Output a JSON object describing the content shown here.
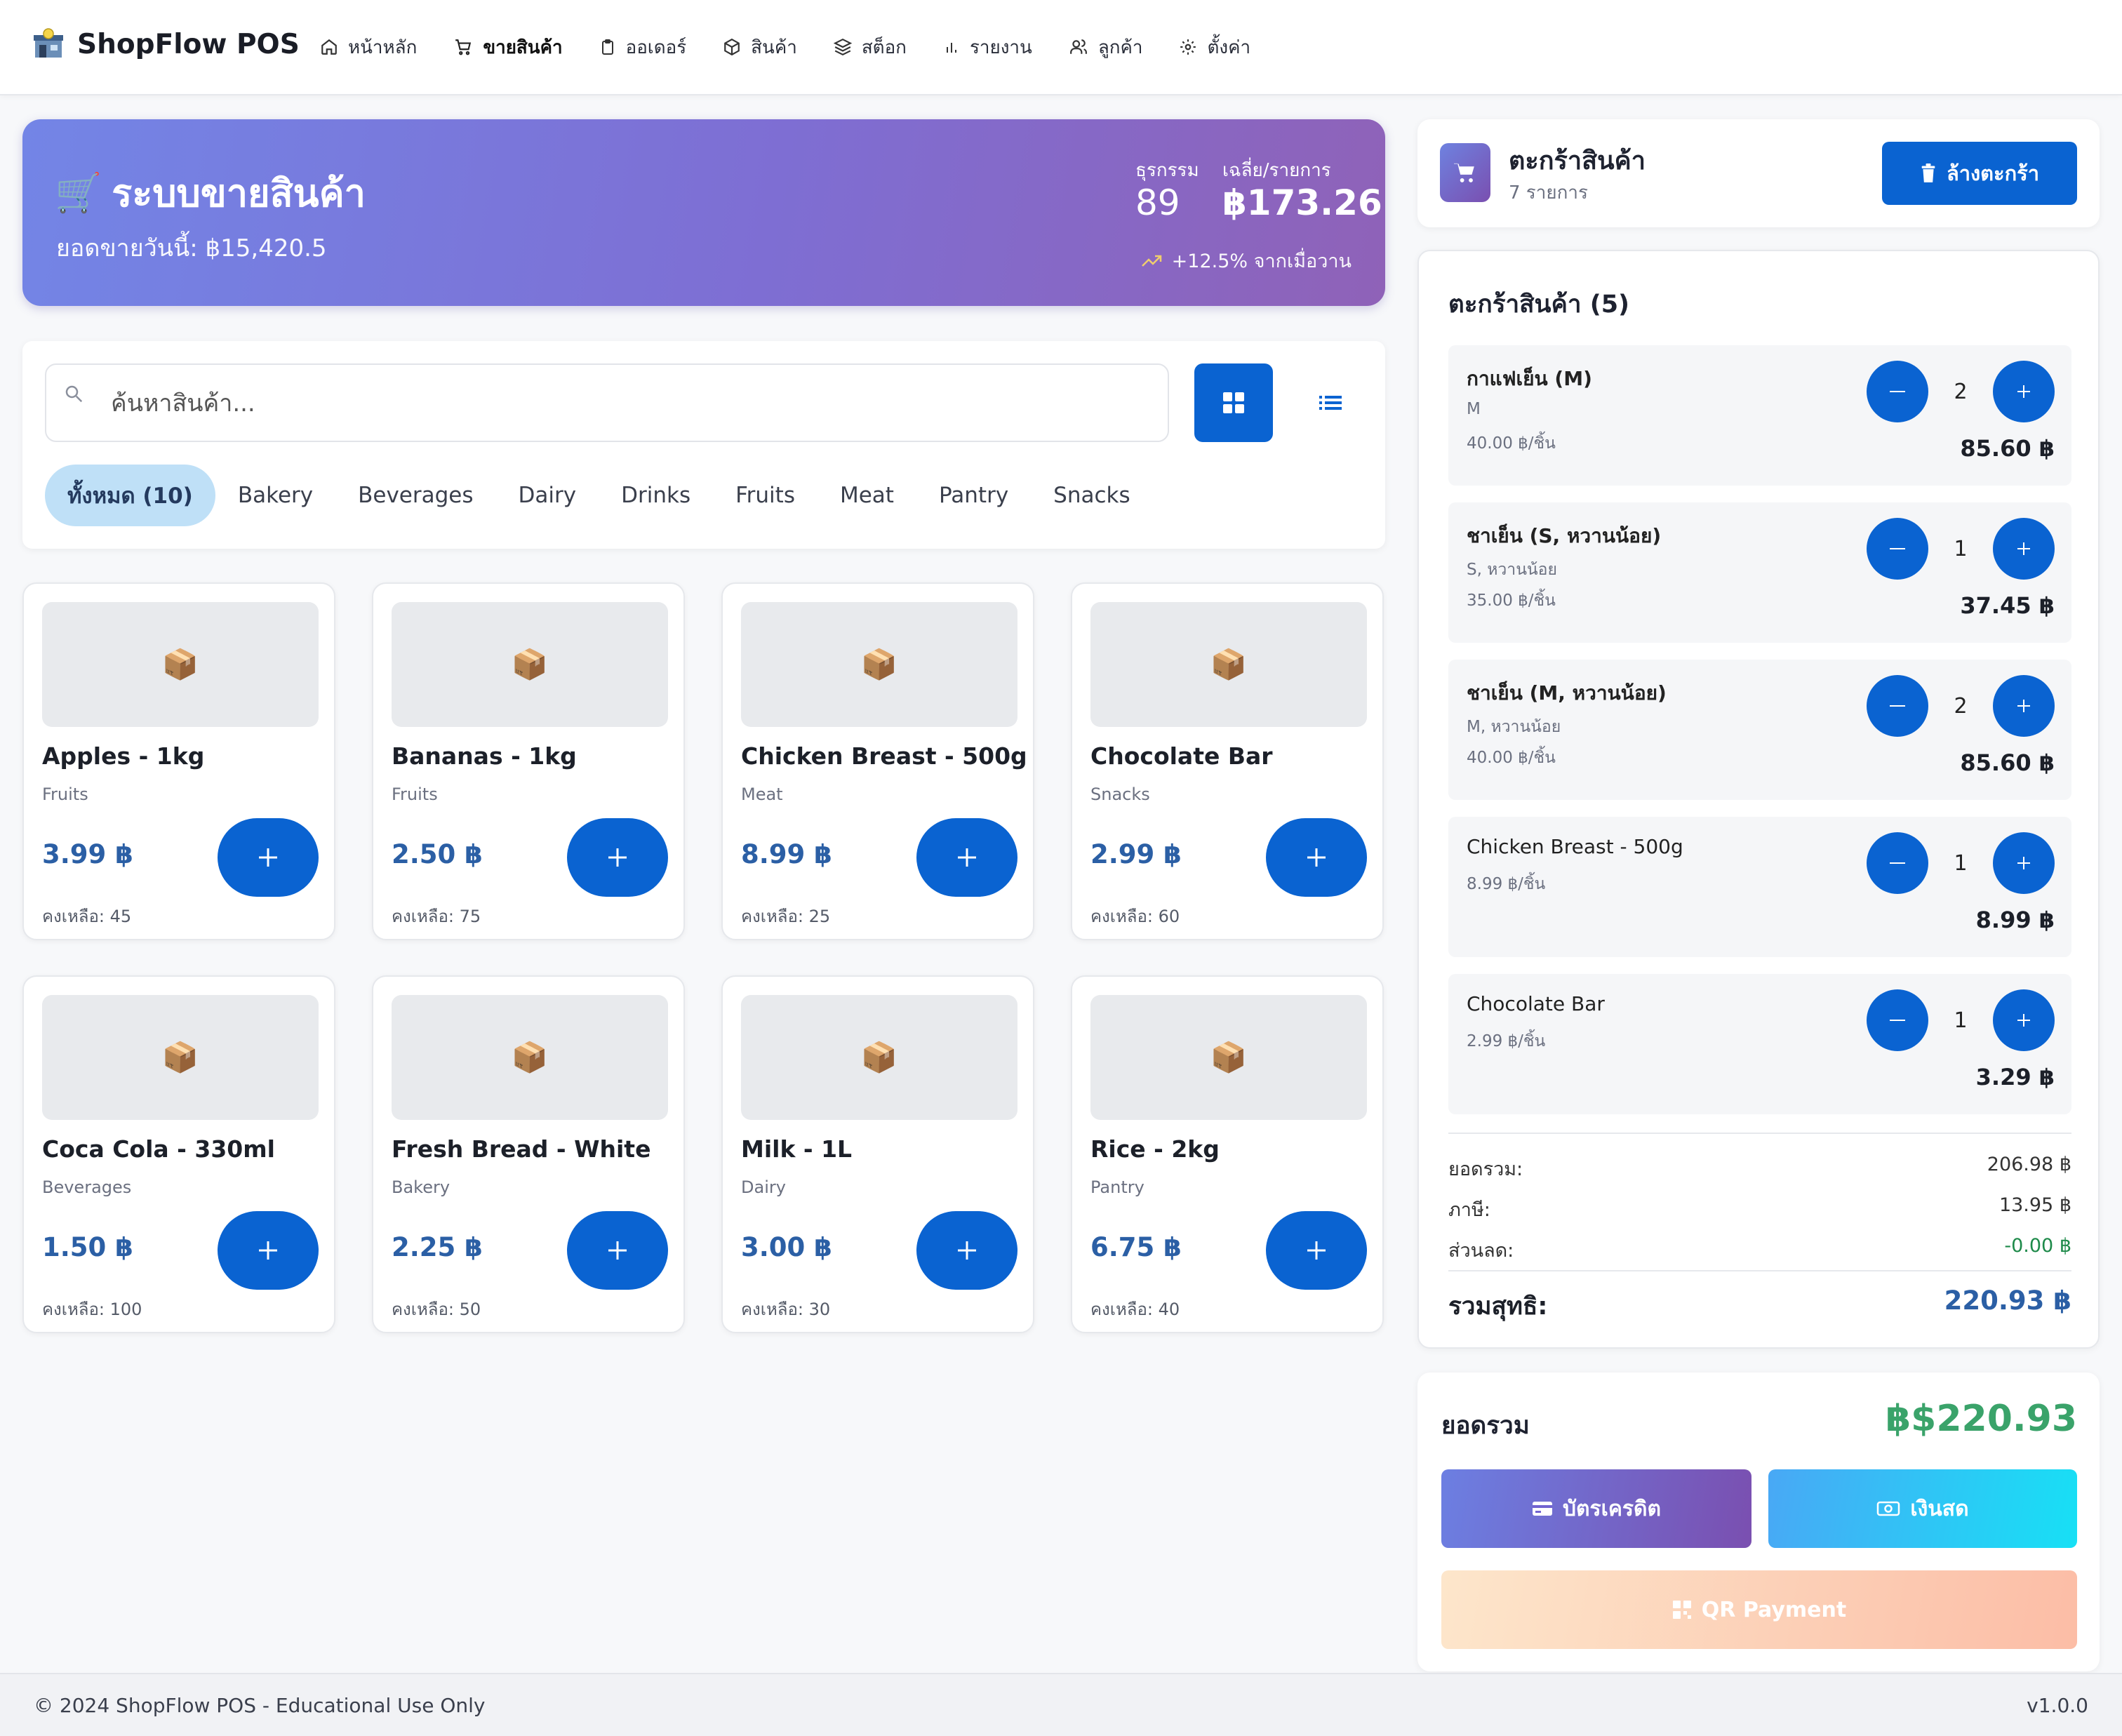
{
  "app": {
    "title": "ShopFlow POS",
    "logo_icon": "store-icon"
  },
  "nav": {
    "items": [
      {
        "label": "หน้าหลัก",
        "icon": "home-icon"
      },
      {
        "label": "ขายสินค้า",
        "icon": "cart-icon",
        "active": true
      },
      {
        "label": "ออเดอร์",
        "icon": "clipboard-icon"
      },
      {
        "label": "สินค้า",
        "icon": "box-icon"
      },
      {
        "label": "สต็อก",
        "icon": "layers-icon"
      },
      {
        "label": "รายงาน",
        "icon": "bar-chart-icon"
      },
      {
        "label": "ลูกค้า",
        "icon": "users-icon"
      },
      {
        "label": "ตั้งค่า",
        "icon": "gear-icon"
      }
    ]
  },
  "hero": {
    "emoji": "🛒",
    "title": "ระบบขายสินค้า",
    "subtitle": "ยอดขายวันนี้: ฿15,420.5",
    "transactions_label": "ธุรกรรม",
    "transactions_value": "89",
    "average_label": "เฉลี่ย/รายการ",
    "average_value": "฿173.26",
    "growth_text": "+12.5% จากเมื่อวาน"
  },
  "search": {
    "placeholder": "ค้นหาสินค้า..."
  },
  "categories": [
    "ทั้งหมด (10)",
    "Bakery",
    "Beverages",
    "Dairy",
    "Drinks",
    "Fruits",
    "Meat",
    "Pantry",
    "Snacks"
  ],
  "products": [
    {
      "name": "Apples - 1kg",
      "category": "Fruits",
      "price": "3.99 ฿",
      "stock": "คงเหลือ: 45",
      "image": "📦"
    },
    {
      "name": "Bananas - 1kg",
      "category": "Fruits",
      "price": "2.50 ฿",
      "stock": "คงเหลือ: 75",
      "image": "📦"
    },
    {
      "name": "Chicken Breast - 500g",
      "category": "Meat",
      "price": "8.99 ฿",
      "stock": "คงเหลือ: 25",
      "image": "📦"
    },
    {
      "name": "Chocolate Bar",
      "category": "Snacks",
      "price": "2.99 ฿",
      "stock": "คงเหลือ: 60",
      "image": "📦"
    },
    {
      "name": "Coca Cola - 330ml",
      "category": "Beverages",
      "price": "1.50 ฿",
      "stock": "คงเหลือ: 100",
      "image": "📦"
    },
    {
      "name": "Fresh Bread - White",
      "category": "Bakery",
      "price": "2.25 ฿",
      "stock": "คงเหลือ: 50",
      "image": "📦"
    },
    {
      "name": "Milk - 1L",
      "category": "Dairy",
      "price": "3.00 ฿",
      "stock": "คงเหลือ: 30",
      "image": "📦"
    },
    {
      "name": "Rice - 2kg",
      "category": "Pantry",
      "price": "6.75 ฿",
      "stock": "คงเหลือ: 40",
      "image": "📦"
    }
  ],
  "cart_header": {
    "title": "ตะกร้าสินค้า",
    "count": "7 รายการ",
    "clear_label": "ล้างตะกร้า"
  },
  "cart": {
    "list_title": "ตะกร้าสินค้า (5)",
    "items": [
      {
        "name": "กาแฟเย็น (M)",
        "options": "M",
        "unit": "40.00 ฿/ชิ้น",
        "qty": "2",
        "total": "85.60 ฿"
      },
      {
        "name": "ชาเย็น (S, หวานน้อย)",
        "options": "S, หวานน้อย",
        "unit": "35.00 ฿/ชิ้น",
        "qty": "1",
        "total": "37.45 ฿"
      },
      {
        "name": "ชาเย็น (M, หวานน้อย)",
        "options": "M, หวานน้อย",
        "unit": "40.00 ฿/ชิ้น",
        "qty": "2",
        "total": "85.60 ฿"
      },
      {
        "name": "Chicken Breast - 500g",
        "options": "",
        "unit": "8.99 ฿/ชิ้น",
        "qty": "1",
        "total": "8.99 ฿"
      },
      {
        "name": "Chocolate Bar",
        "options": "",
        "unit": "2.99 ฿/ชิ้น",
        "qty": "1",
        "total": "3.29 ฿"
      }
    ],
    "summary": {
      "subtotal_label": "ยอดรวม:",
      "subtotal": "206.98 ฿",
      "tax_label": "ภาษี:",
      "tax": "13.95 ฿",
      "discount_label": "ส่วนลด:",
      "discount": "-0.00 ฿",
      "net_label": "รวมสุทธิ:",
      "net": "220.93 ฿"
    }
  },
  "payment": {
    "total_label": "ยอดรวม",
    "total_value": "฿$220.93",
    "card_label": "บัตรเครดิต",
    "cash_label": "เงินสด",
    "qr_label": "QR Payment"
  },
  "footer": {
    "copyright": "© 2024 ShopFlow POS - Educational Use Only",
    "version": "v1.0.0"
  },
  "colors": {
    "primary": "#0a63d1",
    "price": "#2b5fa5",
    "total_green": "#3aa36a",
    "discount_green": "#1e8a4a"
  }
}
